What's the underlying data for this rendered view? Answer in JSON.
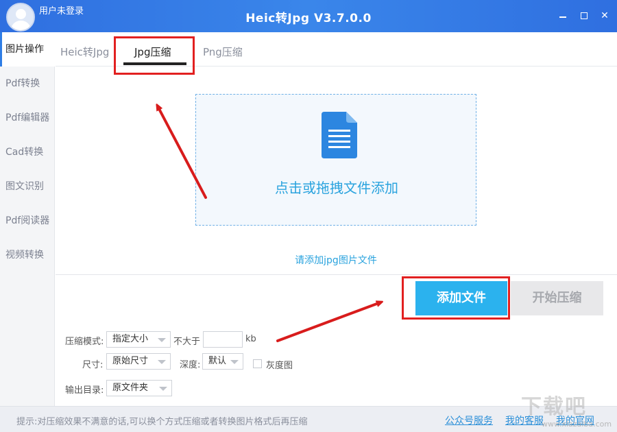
{
  "titlebar": {
    "user_label": "用户未登录",
    "app_title": "Heic转Jpg V3.7.0.0",
    "close_glyph": "✕"
  },
  "sidebar": {
    "items": [
      {
        "label": "图片操作"
      },
      {
        "label": "Pdf转换"
      },
      {
        "label": "Pdf编辑器"
      },
      {
        "label": "Cad转换"
      },
      {
        "label": "图文识别"
      },
      {
        "label": "Pdf阅读器"
      },
      {
        "label": "视频转换"
      }
    ]
  },
  "tabs": [
    {
      "label": "Heic转Jpg"
    },
    {
      "label": "Jpg压缩"
    },
    {
      "label": "Png压缩"
    }
  ],
  "dropzone": {
    "text": "点击或拖拽文件添加",
    "icon": "document-icon"
  },
  "hint": "请添加jpg图片文件",
  "buttons": {
    "add_files": "添加文件",
    "start_compress": "开始压缩"
  },
  "settings": {
    "mode_label": "压缩模式:",
    "mode_value": "指定大小",
    "not_exceed_label": "不大于",
    "size_value": "",
    "unit": "kb",
    "size_label": "尺寸:",
    "size_select": "原始尺寸",
    "depth_label": "深度:",
    "depth_value": "默认",
    "grayscale_label": "灰度图",
    "output_label": "输出目录:",
    "output_value": "原文件夹"
  },
  "footer": {
    "tip": "提示:对压缩效果不满意的话,可以换个方式压缩或者转换图片格式后再压缩",
    "links": [
      "公众号服务",
      "我的客服",
      "我的官网"
    ]
  },
  "watermark": {
    "text": "下载吧",
    "url": "www.xiazaiba.com"
  },
  "colors": {
    "titlebar": "#2f6fe0",
    "accent": "#2bb2ee",
    "annotation": "#e22020"
  }
}
